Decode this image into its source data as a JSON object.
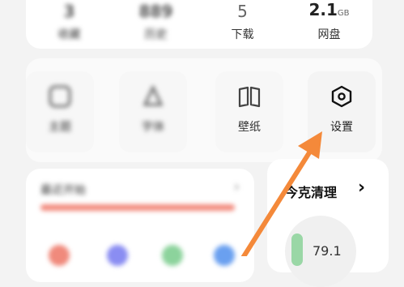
{
  "stats": [
    {
      "value": "3",
      "label": "收藏"
    },
    {
      "value": "889",
      "label": "历史"
    },
    {
      "value": "5",
      "label": "下载"
    },
    {
      "value": "2.1",
      "unit": "GB",
      "label": "网盘"
    }
  ],
  "tools": [
    {
      "label": "主题",
      "icon": "theme-icon"
    },
    {
      "label": "字体",
      "icon": "font-icon"
    },
    {
      "label": "壁纸",
      "icon": "book-icon"
    },
    {
      "label": "设置",
      "icon": "settings-icon"
    }
  ],
  "recent": {
    "title": "最近开始",
    "chevron": "›"
  },
  "cleaner": {
    "title": "今克清理",
    "chevron": "›",
    "value": "79.1"
  },
  "colors": {
    "accent_red": "#f28b7e",
    "arrow": "#f4893a",
    "bar": "#9ad7a6"
  }
}
